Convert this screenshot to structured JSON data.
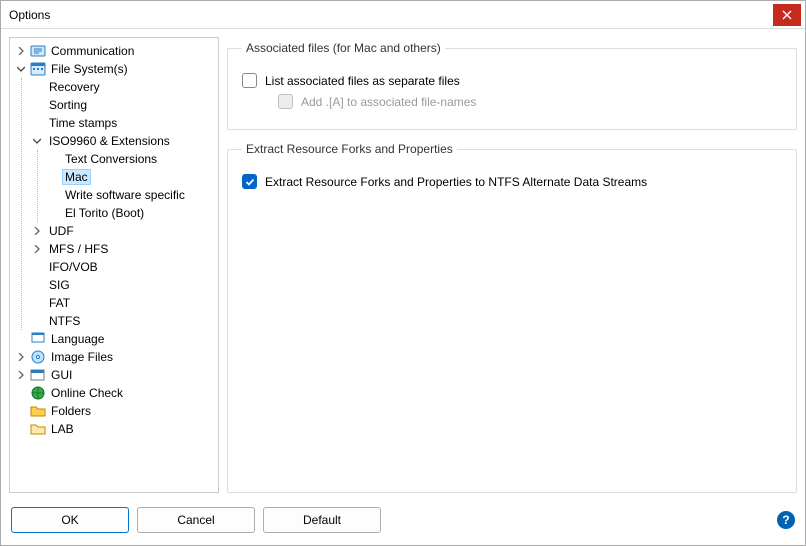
{
  "window": {
    "title": "Options"
  },
  "tree": {
    "communication": "Communication",
    "file_system": "File System(s)",
    "recovery": "Recovery",
    "sorting": "Sorting",
    "time_stamps": "Time stamps",
    "iso9960": "ISO9960 & Extensions",
    "text_conversions": "Text Conversions",
    "mac": "Mac",
    "write_software": "Write software specific",
    "el_torito": "El Torito (Boot)",
    "udf": "UDF",
    "mfs_hfs": "MFS / HFS",
    "ifo_vob": "IFO/VOB",
    "sig": "SIG",
    "fat": "FAT",
    "ntfs": "NTFS",
    "language": "Language",
    "image_files": "Image Files",
    "gui": "GUI",
    "online_check": "Online Check",
    "folders": "Folders",
    "lab": "LAB"
  },
  "group1": {
    "legend": "Associated files (for Mac and others)",
    "cb_list": "List associated files as separate files",
    "cb_add_a": "Add .[A] to associated file-names"
  },
  "group2": {
    "legend": "Extract Resource Forks and Properties",
    "cb_extract": "Extract Resource Forks and Properties to NTFS Alternate Data Streams"
  },
  "buttons": {
    "ok": "OK",
    "cancel": "Cancel",
    "default": "Default"
  }
}
